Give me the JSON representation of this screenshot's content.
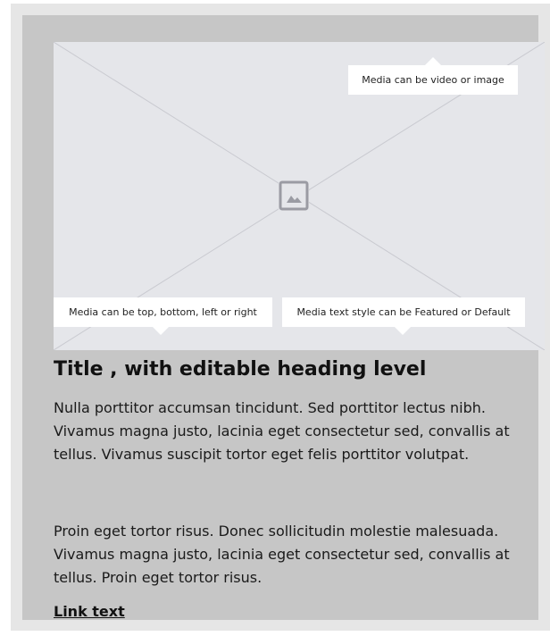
{
  "media": {
    "icon": "image-icon",
    "callouts": {
      "top": "Media can be video or image",
      "bottom_left": "Media can be top, bottom, left or right",
      "bottom_right": "Media text style can be Featured or Default"
    }
  },
  "card": {
    "title": "Title , with editable heading level",
    "paragraphs": [
      "Nulla porttitor accumsan tincidunt. Sed porttitor lectus nibh. Vivamus magna justo, lacinia eget consectetur sed, convallis at tellus. Vivamus suscipit tortor eget felis porttitor volutpat.",
      "Proin eget tortor risus. Donec sollicitudin molestie malesuada. Vivamus magna justo, lacinia eget consectetur sed, convallis at tellus. Proin eget tortor risus."
    ],
    "link_text": "Link text"
  },
  "colors": {
    "outer_bg": "#e6e6e6",
    "card_bg": "#c6c6c6",
    "media_bg": "#e5e6ea",
    "placeholder_line": "#c9cad0",
    "icon_stroke": "#9a9ba3"
  }
}
